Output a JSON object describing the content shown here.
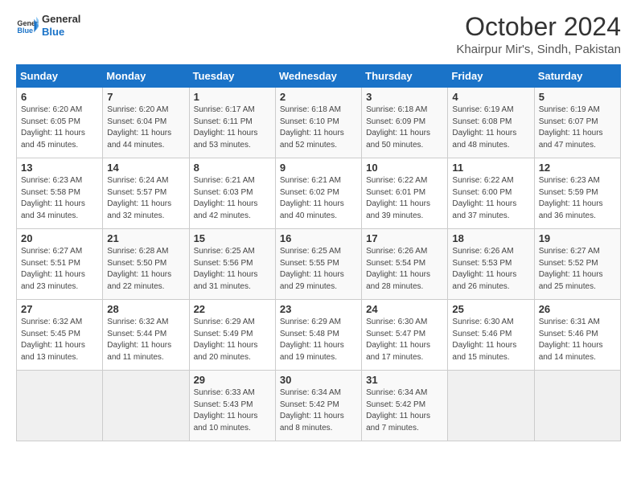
{
  "header": {
    "title": "October 2024",
    "location": "Khairpur Mir's, Sindh, Pakistan"
  },
  "weekdays": [
    "Sunday",
    "Monday",
    "Tuesday",
    "Wednesday",
    "Thursday",
    "Friday",
    "Saturday"
  ],
  "days": [
    {
      "date": 1,
      "col": 2,
      "sunrise": "6:17 AM",
      "sunset": "6:11 PM",
      "daylight": "11 hours and 53 minutes."
    },
    {
      "date": 2,
      "col": 3,
      "sunrise": "6:18 AM",
      "sunset": "6:10 PM",
      "daylight": "11 hours and 52 minutes."
    },
    {
      "date": 3,
      "col": 4,
      "sunrise": "6:18 AM",
      "sunset": "6:09 PM",
      "daylight": "11 hours and 50 minutes."
    },
    {
      "date": 4,
      "col": 5,
      "sunrise": "6:19 AM",
      "sunset": "6:08 PM",
      "daylight": "11 hours and 48 minutes."
    },
    {
      "date": 5,
      "col": 6,
      "sunrise": "6:19 AM",
      "sunset": "6:07 PM",
      "daylight": "11 hours and 47 minutes."
    },
    {
      "date": 6,
      "col": 0,
      "sunrise": "6:20 AM",
      "sunset": "6:05 PM",
      "daylight": "11 hours and 45 minutes."
    },
    {
      "date": 7,
      "col": 1,
      "sunrise": "6:20 AM",
      "sunset": "6:04 PM",
      "daylight": "11 hours and 44 minutes."
    },
    {
      "date": 8,
      "col": 2,
      "sunrise": "6:21 AM",
      "sunset": "6:03 PM",
      "daylight": "11 hours and 42 minutes."
    },
    {
      "date": 9,
      "col": 3,
      "sunrise": "6:21 AM",
      "sunset": "6:02 PM",
      "daylight": "11 hours and 40 minutes."
    },
    {
      "date": 10,
      "col": 4,
      "sunrise": "6:22 AM",
      "sunset": "6:01 PM",
      "daylight": "11 hours and 39 minutes."
    },
    {
      "date": 11,
      "col": 5,
      "sunrise": "6:22 AM",
      "sunset": "6:00 PM",
      "daylight": "11 hours and 37 minutes."
    },
    {
      "date": 12,
      "col": 6,
      "sunrise": "6:23 AM",
      "sunset": "5:59 PM",
      "daylight": "11 hours and 36 minutes."
    },
    {
      "date": 13,
      "col": 0,
      "sunrise": "6:23 AM",
      "sunset": "5:58 PM",
      "daylight": "11 hours and 34 minutes."
    },
    {
      "date": 14,
      "col": 1,
      "sunrise": "6:24 AM",
      "sunset": "5:57 PM",
      "daylight": "11 hours and 32 minutes."
    },
    {
      "date": 15,
      "col": 2,
      "sunrise": "6:25 AM",
      "sunset": "5:56 PM",
      "daylight": "11 hours and 31 minutes."
    },
    {
      "date": 16,
      "col": 3,
      "sunrise": "6:25 AM",
      "sunset": "5:55 PM",
      "daylight": "11 hours and 29 minutes."
    },
    {
      "date": 17,
      "col": 4,
      "sunrise": "6:26 AM",
      "sunset": "5:54 PM",
      "daylight": "11 hours and 28 minutes."
    },
    {
      "date": 18,
      "col": 5,
      "sunrise": "6:26 AM",
      "sunset": "5:53 PM",
      "daylight": "11 hours and 26 minutes."
    },
    {
      "date": 19,
      "col": 6,
      "sunrise": "6:27 AM",
      "sunset": "5:52 PM",
      "daylight": "11 hours and 25 minutes."
    },
    {
      "date": 20,
      "col": 0,
      "sunrise": "6:27 AM",
      "sunset": "5:51 PM",
      "daylight": "11 hours and 23 minutes."
    },
    {
      "date": 21,
      "col": 1,
      "sunrise": "6:28 AM",
      "sunset": "5:50 PM",
      "daylight": "11 hours and 22 minutes."
    },
    {
      "date": 22,
      "col": 2,
      "sunrise": "6:29 AM",
      "sunset": "5:49 PM",
      "daylight": "11 hours and 20 minutes."
    },
    {
      "date": 23,
      "col": 3,
      "sunrise": "6:29 AM",
      "sunset": "5:48 PM",
      "daylight": "11 hours and 19 minutes."
    },
    {
      "date": 24,
      "col": 4,
      "sunrise": "6:30 AM",
      "sunset": "5:47 PM",
      "daylight": "11 hours and 17 minutes."
    },
    {
      "date": 25,
      "col": 5,
      "sunrise": "6:30 AM",
      "sunset": "5:46 PM",
      "daylight": "11 hours and 15 minutes."
    },
    {
      "date": 26,
      "col": 6,
      "sunrise": "6:31 AM",
      "sunset": "5:46 PM",
      "daylight": "11 hours and 14 minutes."
    },
    {
      "date": 27,
      "col": 0,
      "sunrise": "6:32 AM",
      "sunset": "5:45 PM",
      "daylight": "11 hours and 13 minutes."
    },
    {
      "date": 28,
      "col": 1,
      "sunrise": "6:32 AM",
      "sunset": "5:44 PM",
      "daylight": "11 hours and 11 minutes."
    },
    {
      "date": 29,
      "col": 2,
      "sunrise": "6:33 AM",
      "sunset": "5:43 PM",
      "daylight": "11 hours and 10 minutes."
    },
    {
      "date": 30,
      "col": 3,
      "sunrise": "6:34 AM",
      "sunset": "5:42 PM",
      "daylight": "11 hours and 8 minutes."
    },
    {
      "date": 31,
      "col": 4,
      "sunrise": "6:34 AM",
      "sunset": "5:42 PM",
      "daylight": "11 hours and 7 minutes."
    }
  ]
}
